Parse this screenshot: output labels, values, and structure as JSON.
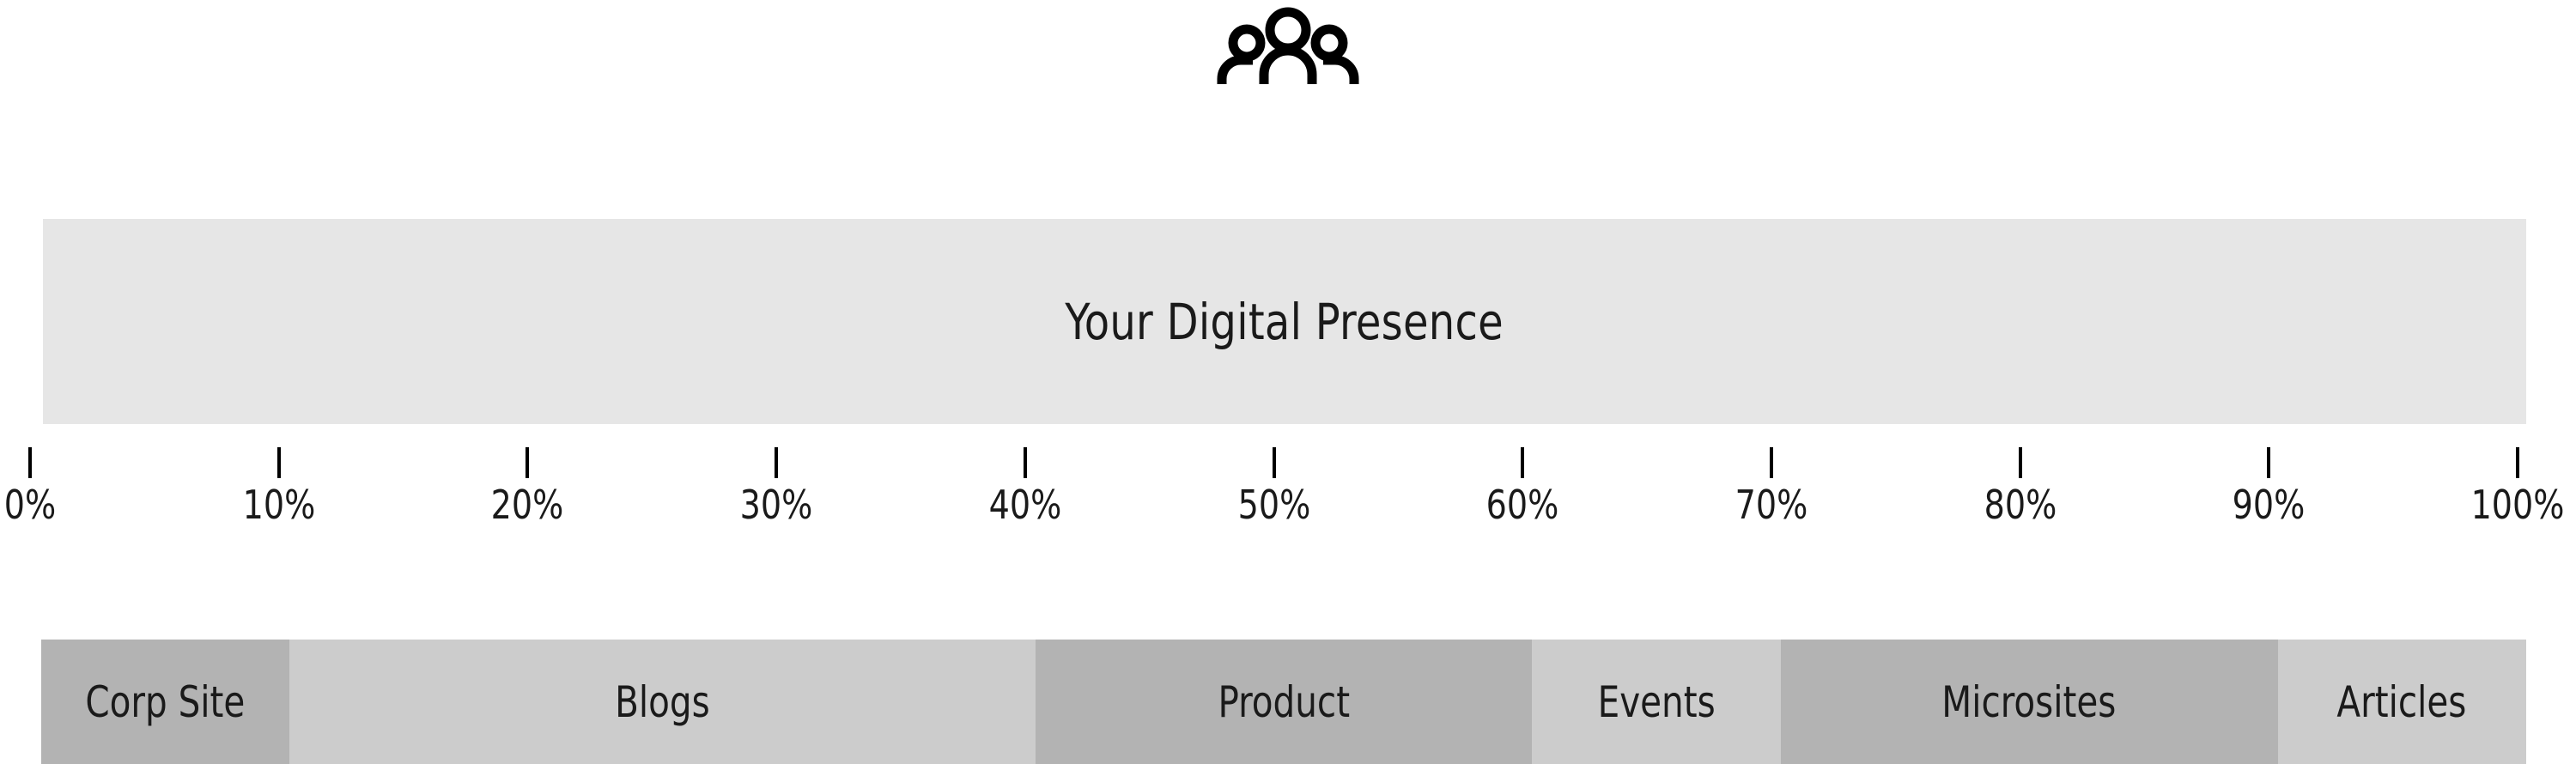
{
  "header": {
    "icon": "people-group-icon"
  },
  "hero": {
    "title": "Your Digital Presence",
    "background_color": "#e6e6e6"
  },
  "axis": {
    "label_suffix": "%",
    "ticks": [
      {
        "value": 0,
        "label": "0%"
      },
      {
        "value": 10,
        "label": "10%"
      },
      {
        "value": 20,
        "label": "20%"
      },
      {
        "value": 30,
        "label": "30%"
      },
      {
        "value": 40,
        "label": "40%"
      },
      {
        "value": 50,
        "label": "50%"
      },
      {
        "value": 60,
        "label": "60%"
      },
      {
        "value": 70,
        "label": "70%"
      },
      {
        "value": 80,
        "label": "80%"
      },
      {
        "value": 90,
        "label": "90%"
      },
      {
        "value": 100,
        "label": "100%"
      }
    ]
  },
  "chart_data": {
    "type": "bar",
    "orientation": "horizontal-stacked",
    "title": "Your Digital Presence",
    "xlabel": "",
    "ylabel": "",
    "xlim": [
      0,
      100
    ],
    "grid": false,
    "legend": "none",
    "axis_tick_labels": [
      "0%",
      "10%",
      "20%",
      "30%",
      "40%",
      "50%",
      "60%",
      "70%",
      "80%",
      "90%",
      "100%"
    ],
    "categories": [
      "Corp Site",
      "Blogs",
      "Product",
      "Events",
      "Microsites",
      "Articles"
    ],
    "values": [
      10,
      30,
      20,
      10,
      20,
      10
    ],
    "segments": [
      {
        "label": "Corp Site",
        "value": 10,
        "color": "#b3b3b3"
      },
      {
        "label": "Blogs",
        "value": 30,
        "color": "#cccccc"
      },
      {
        "label": "Product",
        "value": 20,
        "color": "#b3b3b3"
      },
      {
        "label": "Events",
        "value": 10,
        "color": "#cccccc"
      },
      {
        "label": "Microsites",
        "value": 20,
        "color": "#b3b3b3"
      },
      {
        "label": "Articles",
        "value": 10,
        "color": "#cccccc"
      }
    ]
  },
  "colors": {
    "band": "#e6e6e6",
    "segment_dark": "#b3b3b3",
    "segment_light": "#cccccc",
    "text": "#1a1a1a",
    "tick": "#000000",
    "background": "#ffffff"
  }
}
